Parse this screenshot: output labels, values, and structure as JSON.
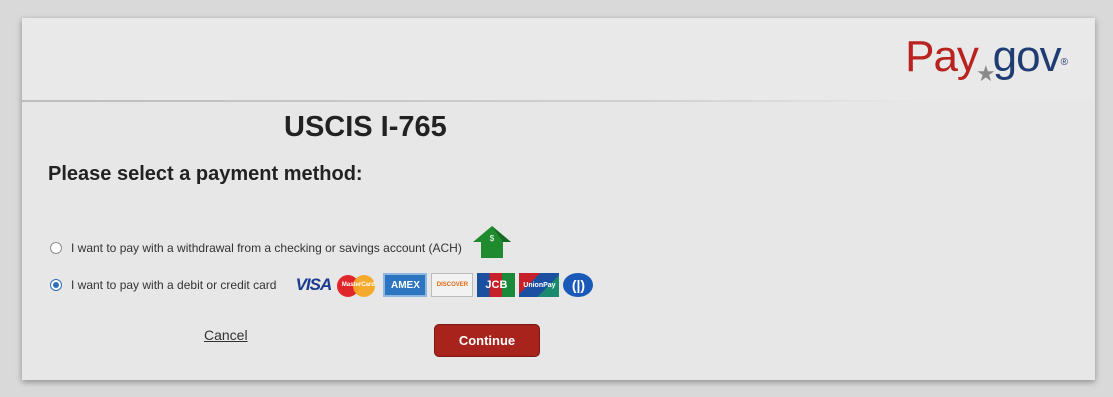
{
  "brand": {
    "logo_pay": "Pay",
    "logo_gov": "gov",
    "logo_reg": "®",
    "logo_star": "★"
  },
  "page": {
    "form_title": "USCIS I-765",
    "prompt": "Please select a payment method:"
  },
  "options": {
    "ach": {
      "label": "I want to pay with a withdrawal from a checking or savings account (ACH)",
      "selected": false,
      "icon": "bank-house-icon"
    },
    "card": {
      "label": "I want to pay with a debit or credit card",
      "selected": true,
      "card_logos": [
        "VISA",
        "MasterCard",
        "AMEX",
        "DISCOVER",
        "JCB",
        "UnionPay",
        "Diners"
      ]
    }
  },
  "actions": {
    "cancel_label": "Cancel",
    "continue_label": "Continue"
  },
  "colors": {
    "brand_red": "#b8231f",
    "brand_blue": "#1f3d73",
    "continue_bg": "#a7231c",
    "radio_selected": "#2f6fb6",
    "house_green": "#1f8a2e"
  }
}
